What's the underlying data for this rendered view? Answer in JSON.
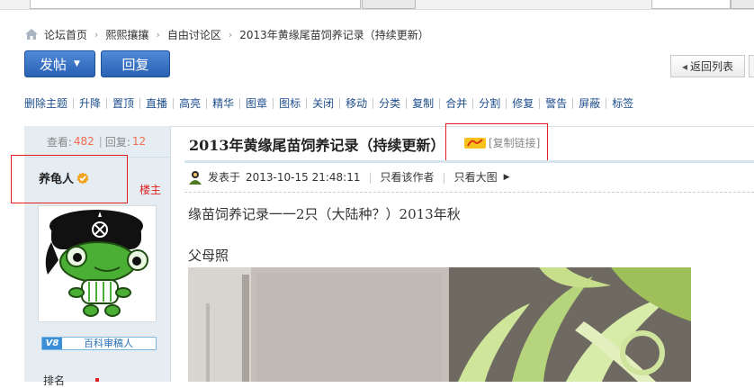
{
  "breadcrumb": {
    "items": [
      "论坛首页",
      "熙熙攘攘",
      "自由讨论区",
      "2013年黄缘尾苗饲养记录（持续更新）"
    ]
  },
  "actions": {
    "post_label": "发帖",
    "reply_label": "回复",
    "back_label": "返回列表"
  },
  "moderation": {
    "items": [
      "删除主题",
      "升降",
      "置顶",
      "直播",
      "高亮",
      "精华",
      "图章",
      "图标",
      "关闭",
      "移动",
      "分类",
      "复制",
      "合并",
      "分割",
      "修复",
      "警告",
      "屏蔽",
      "标签"
    ]
  },
  "stats": {
    "views_label": "查看:",
    "views": "482",
    "replies_label": "回复:",
    "replies": "12"
  },
  "author": {
    "name": "养龟人",
    "role": "楼主",
    "rank_level": "V8",
    "rank_title": "百科审稿人",
    "rank_field_label": "排名"
  },
  "post": {
    "title": "2013年黄缘尾苗饲养记录（持续更新）",
    "copy_link": "[复制链接]",
    "posted_label": "发表于",
    "posted_time": "2013-10-15 21:48:11",
    "only_author": "只看该作者",
    "big_image": "只看大图",
    "line1": "缘苗饲养记录一一2只（大陆种？）2013年秋",
    "line2": "父母照"
  },
  "colors": {
    "accent_blue": "#2a61b3",
    "link_blue": "#1e4e8c",
    "highlight_red": "#e02020",
    "stat_orange": "#f26c4f",
    "sidebar_bg": "#e5edf2"
  },
  "icons": {
    "home": "home-icon",
    "verified": "verified-badge-icon",
    "copy": "copy-link-icon",
    "poster": "online-user-icon",
    "more": "caret-right-icon"
  }
}
